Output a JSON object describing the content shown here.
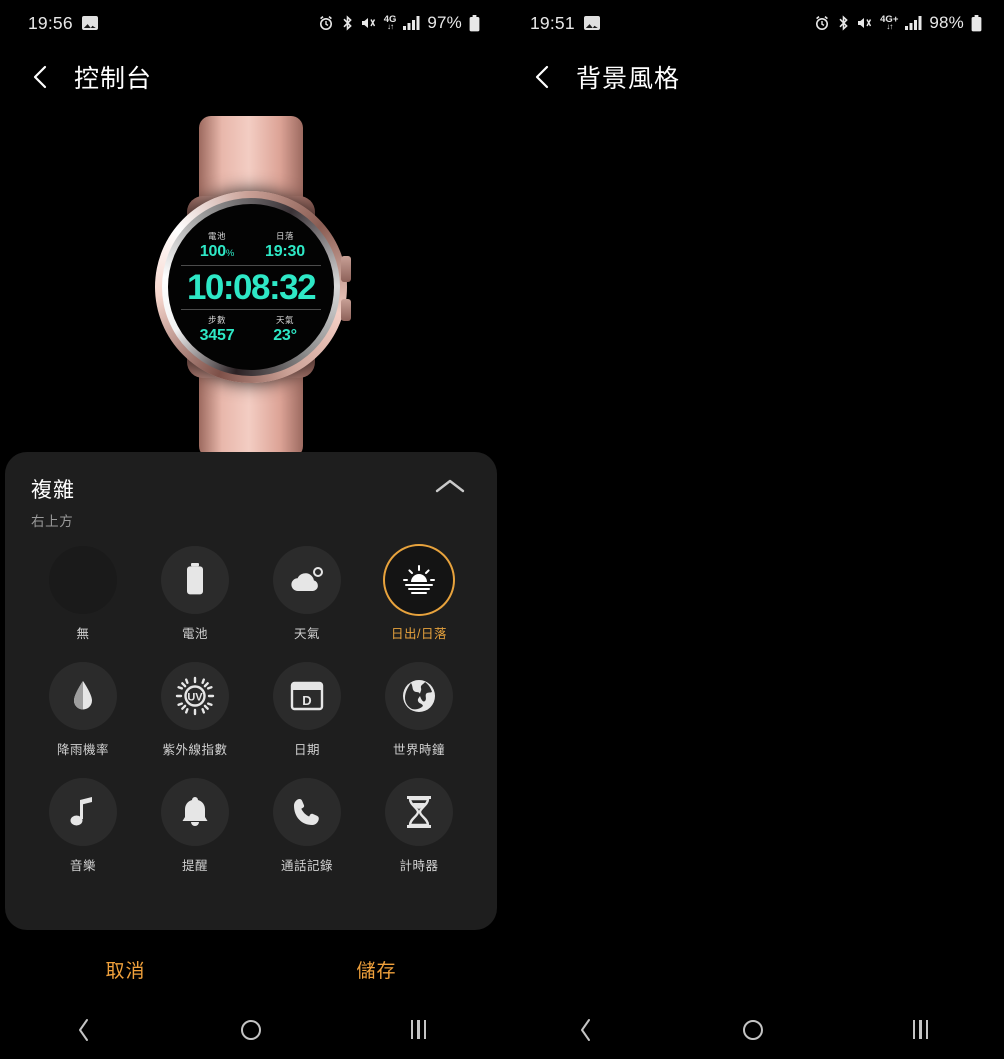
{
  "left": {
    "status": {
      "time": "19:56",
      "battery_percent": "97%",
      "network": "4G",
      "icons": [
        "image-icon",
        "alarm-icon",
        "bluetooth-icon",
        "mute-icon",
        "network-4g-icon",
        "signal-icon",
        "battery-icon"
      ]
    },
    "header": {
      "back": "back-icon",
      "title": "控制台"
    },
    "watch": {
      "complications": {
        "top_left": {
          "label": "電池",
          "value": "100",
          "unit": "%"
        },
        "top_right": {
          "label": "日落",
          "value": "19:30",
          "unit": ""
        },
        "bottom_left": {
          "label": "步數",
          "value": "3457",
          "unit": ""
        },
        "bottom_right": {
          "label": "天氣",
          "value": "23°",
          "unit": ""
        }
      },
      "time": "10:08:32",
      "accent_color": "#2ee8c6",
      "band_color": "#e8b7ab"
    },
    "sheet": {
      "title": "複雜",
      "subtitle": "右上方",
      "collapse_icon": "chevron-up-icon",
      "items": [
        {
          "label": "無",
          "icon": "none-icon",
          "selected": false
        },
        {
          "label": "電池",
          "icon": "battery-icon",
          "selected": false
        },
        {
          "label": "天氣",
          "icon": "cloud-weather-icon",
          "selected": false
        },
        {
          "label": "日出/日落",
          "icon": "sunrise-sunset-icon",
          "selected": true
        },
        {
          "label": "降雨機率",
          "icon": "raindrop-icon",
          "selected": false
        },
        {
          "label": "紫外線指數",
          "icon": "uv-index-icon",
          "selected": false
        },
        {
          "label": "日期",
          "icon": "calendar-date-icon",
          "selected": false
        },
        {
          "label": "世界時鐘",
          "icon": "globe-world-clock-icon",
          "selected": false
        },
        {
          "label": "音樂",
          "icon": "music-note-icon",
          "selected": false
        },
        {
          "label": "提醒",
          "icon": "bell-reminder-icon",
          "selected": false
        },
        {
          "label": "通話記錄",
          "icon": "phone-call-log-icon",
          "selected": false
        },
        {
          "label": "計時器",
          "icon": "hourglass-timer-icon",
          "selected": false
        }
      ]
    },
    "actions": {
      "cancel": "取消",
      "save": "儲存",
      "accent_color": "#f0a13c"
    }
  },
  "right": {
    "status": {
      "time": "19:51",
      "battery_percent": "98%",
      "network": "4G+"
    },
    "header": {
      "back": "back-icon",
      "title": "背景風格"
    },
    "swatches": [
      {
        "name": "solid-black",
        "selected": false
      },
      {
        "name": "teal-triangles",
        "selected": false
      },
      {
        "name": "blue-chevron",
        "selected": false
      },
      {
        "name": "darkblue-lines",
        "selected": false
      },
      {
        "name": "blue-organic",
        "selected": false
      },
      {
        "name": "blue-dots",
        "selected": false
      },
      {
        "name": "purple-triangles",
        "selected": false
      },
      {
        "name": "purple-chevron",
        "selected": false
      },
      {
        "name": "purple-lines",
        "selected": true
      },
      {
        "name": "magenta-organic",
        "selected": false
      },
      {
        "name": "magenta-dots",
        "selected": false
      }
    ],
    "selection_color": "#d9a04a"
  },
  "navbar": {
    "back": "nav-back-icon",
    "home": "nav-home-icon",
    "recents": "nav-recents-icon"
  }
}
